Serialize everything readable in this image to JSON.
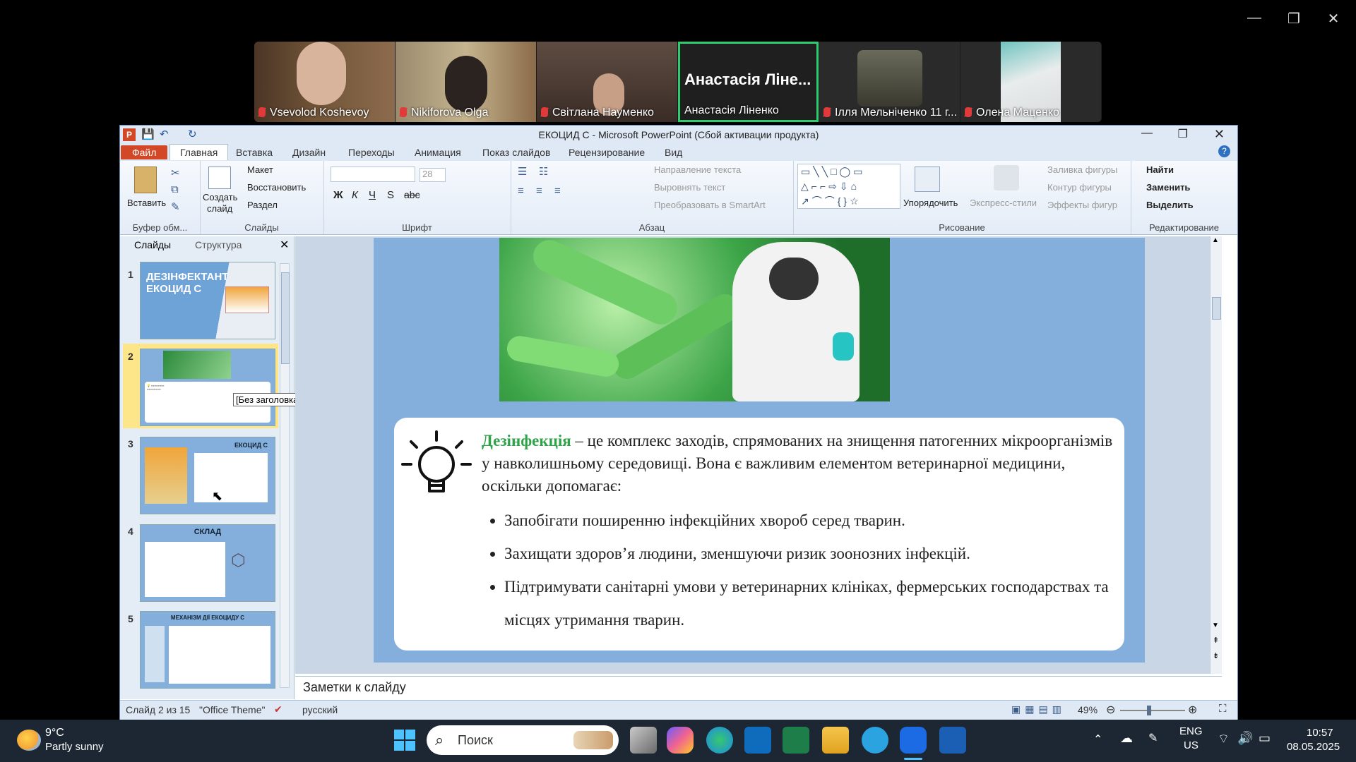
{
  "zoom": {
    "participants": [
      {
        "name": "Vsevolod Koshevoy",
        "muted": true
      },
      {
        "name": "Nikiforova Olga",
        "muted": true
      },
      {
        "name": "Світлана Науменко",
        "muted": true
      },
      {
        "name": "Анастасія Ліненко",
        "muted": false,
        "big_label": "Анастасія Ліне..."
      },
      {
        "name": "Ілля Мельніченко 11 г...",
        "muted": true
      },
      {
        "name": "Олена Маценко",
        "muted": true
      }
    ]
  },
  "window": {
    "title": "ЕКОЦИД С  -  Microsoft PowerPoint (Сбой активации продукта)"
  },
  "ribbon_tabs": [
    "Файл",
    "Главная",
    "Вставка",
    "Дизайн",
    "Переходы",
    "Анимация",
    "Показ слайдов",
    "Рецензирование",
    "Вид"
  ],
  "ribbon": {
    "clipboard": {
      "paste": "Вставить",
      "label": "Буфер обм..."
    },
    "slides": {
      "create": "Создать",
      "slide": "слайд",
      "layout": "Макет",
      "reset": "Восстановить",
      "section": "Раздел",
      "label": "Слайды"
    },
    "font": {
      "size": "28",
      "label": "Шрифт"
    },
    "paragraph": {
      "direction": "Направление текста",
      "align": "Выровнять текст",
      "smartart": "Преобразовать в SmartArt",
      "label": "Абзац"
    },
    "drawing": {
      "arrange": "Упорядочить",
      "styles": "Экспресс-стили",
      "fill": "Заливка фигуры",
      "outline": "Контур фигуры",
      "effects": "Эффекты фигур",
      "label": "Рисование"
    },
    "editing": {
      "find": "Найти",
      "replace": "Заменить",
      "select": "Выделить",
      "label": "Редактирование"
    }
  },
  "panel_tabs": [
    "Слайды",
    "Структура"
  ],
  "thumbnails": [
    {
      "num": "1",
      "title": "ДЕЗІНФЕКТАНТ ЕКОЦИД С"
    },
    {
      "num": "2",
      "title": ""
    },
    {
      "num": "3",
      "title": "ЕКОЦИД С"
    },
    {
      "num": "4",
      "title": "СКЛАД"
    },
    {
      "num": "5",
      "title": "МЕХАНІЗМ ДІЇ ЕКОЦИДУ С"
    }
  ],
  "tooltip": "[Без заголовка]",
  "slide": {
    "keyword": "Дезінфекція",
    "intro": " – це комплекс заходів, спрямованих на знищення патогенних мікроорганізмів у навколишньому середовищі. Вона є важливим елементом ветеринарної медицини, оскільки допомагає:",
    "bullets": [
      "Запобігати поширенню інфекційних хвороб серед тварин.",
      "Захищати здоров’я людини, зменшуючи ризик зоонозних інфекцій.",
      "Підтримувати санітарні умови у ветеринарних клініках, фермерських господарствах та місцях утримання тварин."
    ]
  },
  "notes_placeholder": "Заметки к слайду",
  "status": {
    "slide": "Слайд 2 из 15",
    "theme": "\"Office Theme\"",
    "lang": "русский",
    "zoom": "49%"
  },
  "taskbar": {
    "weather_temp": "9°C",
    "weather_desc": "Partly sunny",
    "search": "Поиск",
    "lang1": "ENG",
    "lang2": "US",
    "time": "10:57",
    "date": "08.05.2025"
  },
  "colors": {
    "accent_green": "#2fa34a",
    "zoom_active": "#2ecc71",
    "slide_bg": "#84aedb"
  }
}
